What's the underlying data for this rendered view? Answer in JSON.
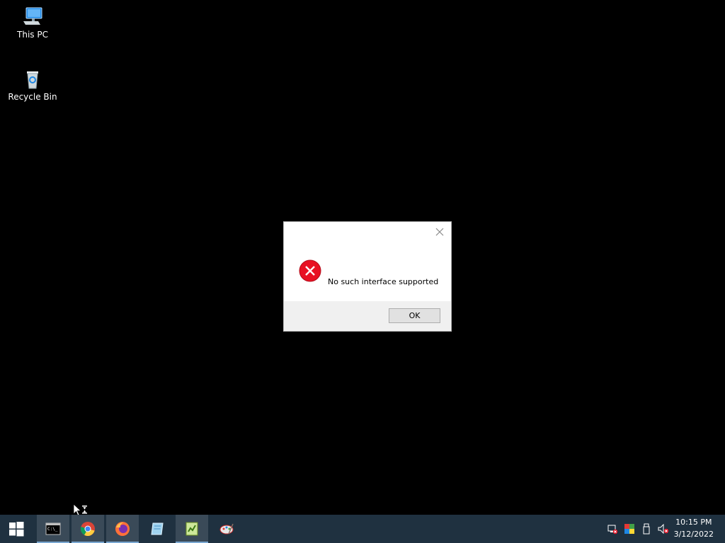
{
  "desktop": {
    "icons": [
      {
        "label": "This PC",
        "icon": "computer-icon"
      },
      {
        "label": "Recycle Bin",
        "icon": "recycle-bin-icon"
      }
    ]
  },
  "dialog": {
    "message": "No such interface supported",
    "ok_label": "OK",
    "icon": "error-icon",
    "colors": {
      "error": "#e81123"
    }
  },
  "taskbar": {
    "start_icon": "windows-start-icon",
    "pinned": [
      {
        "name": "command-prompt",
        "icon": "command-prompt-icon",
        "active": true
      },
      {
        "name": "chrome",
        "icon": "chrome-icon",
        "active": true
      },
      {
        "name": "firefox",
        "icon": "firefox-icon",
        "active": true
      },
      {
        "name": "notepad-app",
        "icon": "notepad-app-icon",
        "active": false
      },
      {
        "name": "notepad-plus",
        "icon": "notepad-plus-icon",
        "active": true
      },
      {
        "name": "paint-app",
        "icon": "paint-app-icon",
        "active": false
      }
    ],
    "tray": [
      "network-icon",
      "color-app-icon",
      "usb-icon",
      "volume-muted-icon"
    ],
    "clock": {
      "time": "10:15 PM",
      "date": "3/12/2022"
    },
    "colors": {
      "background": "#1f3140",
      "active_accent": "#7aa7d2"
    }
  }
}
